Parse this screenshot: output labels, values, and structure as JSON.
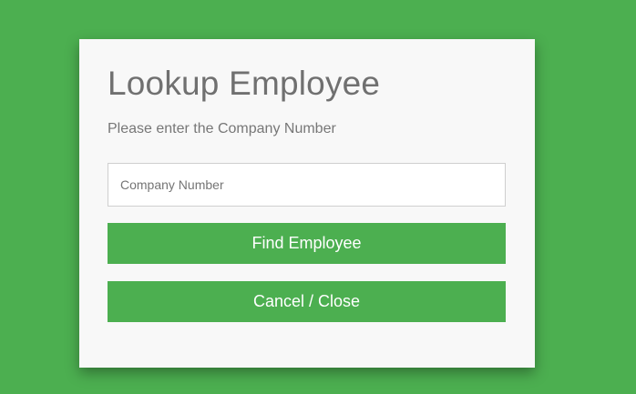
{
  "colors": {
    "background": "#4caf50",
    "dialog_background": "#f8f8f8",
    "button": "#4caf50",
    "button_text": "#ffffff"
  },
  "dialog": {
    "title": "Lookup Employee",
    "subtitle": "Please enter the Company Number",
    "company_number_input": {
      "placeholder": "Company Number",
      "value": ""
    },
    "find_button_label": "Find Employee",
    "cancel_button_label": "Cancel / Close"
  }
}
